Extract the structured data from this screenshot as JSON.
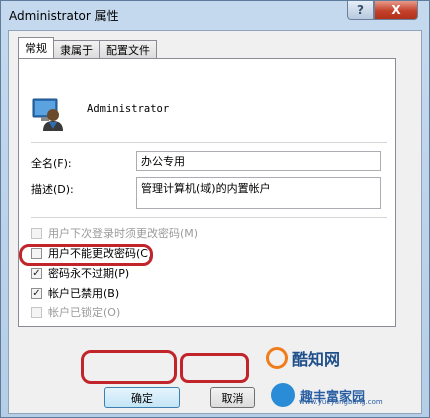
{
  "window": {
    "title": "Administrator 属性",
    "help_glyph": "?",
    "close_glyph": "X"
  },
  "tabs": [
    {
      "label": "常规",
      "active": true
    },
    {
      "label": "隶属于",
      "active": false
    },
    {
      "label": "配置文件",
      "active": false
    }
  ],
  "general": {
    "username": "Administrator",
    "fullname_label": "全名(F):",
    "fullname_value": "办公专用",
    "description_label": "描述(D):",
    "description_value": "管理计算机(域)的内置帐户",
    "checkboxes": [
      {
        "label": "用户下次登录时须更改密码(M)",
        "checked": false,
        "enabled": false
      },
      {
        "label": "用户不能更改密码(C)",
        "checked": false,
        "enabled": true
      },
      {
        "label": "密码永不过期(P)",
        "checked": true,
        "enabled": true
      },
      {
        "label": "帐户已禁用(B)",
        "checked": true,
        "enabled": true
      },
      {
        "label": "帐户已锁定(O)",
        "checked": false,
        "enabled": false
      }
    ]
  },
  "buttons": {
    "ok": "确定",
    "cancel": "取消"
  },
  "watermark": {
    "logo_text": "酷知网",
    "site_name": "趣丰富家园",
    "site_url": "www.yueyangbang.com"
  },
  "colors": {
    "highlight": "#c2242b"
  }
}
